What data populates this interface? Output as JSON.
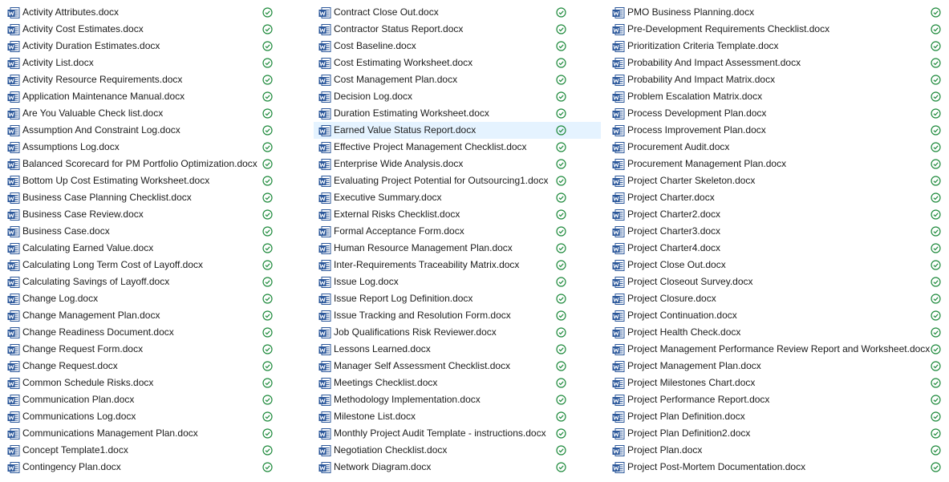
{
  "view": {
    "icon": "word-document-icon",
    "status_icon": "sync-available-check-icon",
    "status_color": "#1e8a3c",
    "selected_color": "#e5f3ff",
    "selected_file": "Earned Value Status Report.docx"
  },
  "columns": [
    {
      "files": [
        "Activity Attributes.docx",
        "Activity Cost Estimates.docx",
        "Activity Duration Estimates.docx",
        "Activity List.docx",
        "Activity Resource Requirements.docx",
        "Application Maintenance Manual.docx",
        "Are You Valuable Check list.docx",
        "Assumption And Constraint Log.docx",
        "Assumptions Log.docx",
        "Balanced Scorecard for PM Portfolio Optimization.docx",
        "Bottom Up Cost Estimating Worksheet.docx",
        "Business Case Planning Checklist.docx",
        "Business Case Review.docx",
        "Business Case.docx",
        "Calculating Earned Value.docx",
        "Calculating Long Term Cost of Layoff.docx",
        "Calculating Savings of Layoff.docx",
        "Change Log.docx",
        "Change Management Plan.docx",
        "Change Readiness Document.docx",
        "Change Request Form.docx",
        "Change Request.docx",
        "Common Schedule Risks.docx",
        "Communication Plan.docx",
        "Communications Log.docx",
        "Communications Management Plan.docx",
        "Concept Template1.docx",
        "Contingency Plan.docx"
      ]
    },
    {
      "files": [
        "Contract Close Out.docx",
        "Contractor Status Report.docx",
        "Cost Baseline.docx",
        "Cost Estimating Worksheet.docx",
        "Cost Management Plan.docx",
        "Decision Log.docx",
        "Duration Estimating Worksheet.docx",
        "Earned Value Status Report.docx",
        "Effective Project Management Checklist.docx",
        "Enterprise Wide Analysis.docx",
        "Evaluating Project Potential for Outsourcing1.docx",
        "Executive Summary.docx",
        "External Risks Checklist.docx",
        "Formal Acceptance Form.docx",
        "Human Resource Management Plan.docx",
        "Inter-Requirements Traceability Matrix.docx",
        "Issue Log.docx",
        "Issue Report Log Definition.docx",
        "Issue Tracking and Resolution Form.docx",
        "Job Qualifications Risk Reviewer.docx",
        "Lessons Learned.docx",
        "Manager Self Assessment Checklist.docx",
        "Meetings Checklist.docx",
        "Methodology Implementation.docx",
        "Milestone List.docx",
        "Monthly Project Audit Template - instructions.docx",
        "Negotiation Checklist.docx",
        "Network Diagram.docx"
      ]
    },
    {
      "files": [
        "PMO Business Planning.docx",
        "Pre-Development Requirements Checklist.docx",
        "Prioritization Criteria Template.docx",
        "Probability And Impact Assessment.docx",
        "Probability And Impact Matrix.docx",
        "Problem Escalation Matrix.docx",
        "Process Development Plan.docx",
        "Process Improvement Plan.docx",
        "Procurement Audit.docx",
        "Procurement Management Plan.docx",
        "Project Charter Skeleton.docx",
        "Project Charter.docx",
        "Project Charter2.docx",
        "Project Charter3.docx",
        "Project Charter4.docx",
        "Project Close Out.docx",
        "Project Closeout Survey.docx",
        "Project Closure.docx",
        "Project Continuation.docx",
        "Project Health Check.docx",
        "Project Management Performance Review Report and Worksheet.docx",
        "Project Management Plan.docx",
        "Project Milestones Chart.docx",
        "Project Performance Report.docx",
        "Project Plan Definition.docx",
        "Project Plan Definition2.docx",
        "Project Plan.docx",
        "Project Post-Mortem Documentation.docx"
      ]
    }
  ]
}
